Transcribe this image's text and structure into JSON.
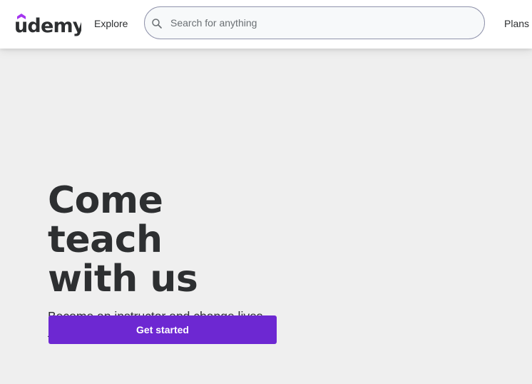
{
  "header": {
    "logo": {
      "text": "udemy",
      "accent_color": "#a435f0"
    },
    "explore_label": "Explore",
    "search": {
      "placeholder": "Search for anything",
      "value": ""
    },
    "plans_label": "Plans & Pricing"
  },
  "hero": {
    "title_line1": "Come teach",
    "title_line2": "with us",
    "subtitle": "Become an instructor and change lives — including your own",
    "cta_label": "Get started"
  },
  "colors": {
    "primary": "#6d28d2",
    "text": "#2d2f31",
    "background": "#efefef",
    "header_background": "#ffffff"
  }
}
